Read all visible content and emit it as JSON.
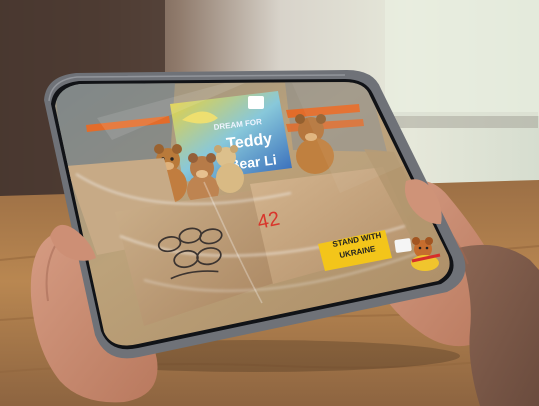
{
  "photo": {
    "banner": {
      "line1": "DREAM FOR",
      "line2": "Teddy",
      "line3": "Bear Li"
    },
    "sign": {
      "line1": "STAND WITH",
      "line2": "UKRAINE"
    },
    "box_marking": "42",
    "colors": {
      "sign_yellow": "#f3c51a",
      "banner_blue": "#2f63b8",
      "banner_yellow": "#f1d12a",
      "shelf_orange": "#e36c2a",
      "teddy_brown": "#b97a3a",
      "table_wood": "#b98751"
    },
    "icon": "cartoon-teddy-sticker-icon"
  }
}
